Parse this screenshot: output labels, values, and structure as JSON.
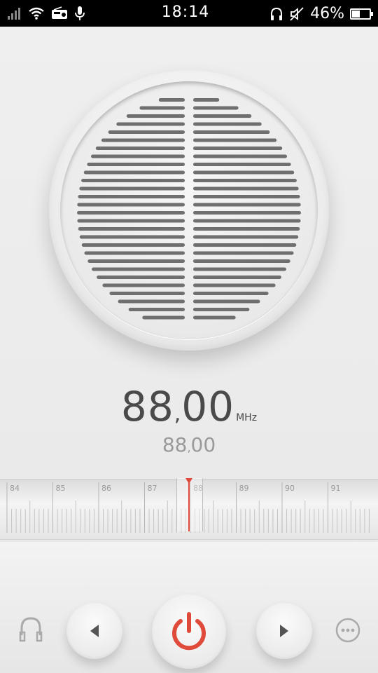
{
  "status_bar": {
    "time": "18:14",
    "battery_percent": "46%",
    "battery_level": 0.46,
    "icons": [
      "signal-icon",
      "wifi-icon",
      "radio-icon",
      "mic-icon",
      "headphone-icon",
      "mute-icon",
      "battery-icon"
    ]
  },
  "tuner": {
    "frequency_int": "88",
    "frequency_dec": "00",
    "unit": "MHz",
    "secondary_int": "88",
    "secondary_dec": "00"
  },
  "dial": {
    "labels": [
      "84",
      "85",
      "86",
      "87",
      "88",
      "89",
      "90",
      "91"
    ],
    "current": 88
  },
  "controls": {
    "icons": [
      "headphone-icon",
      "prev-icon",
      "power-icon",
      "next-icon",
      "more-icon"
    ],
    "accent_color": "#e04a3a"
  }
}
